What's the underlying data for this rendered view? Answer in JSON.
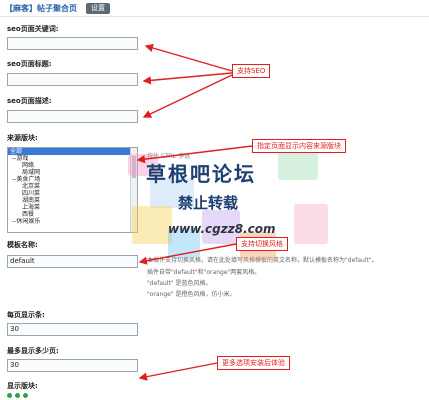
{
  "header": {
    "tag": "【麻客】",
    "title": "帖子聚合页",
    "settings_label": "设置"
  },
  "form": {
    "seo_keywords_label": "seo页面关键词:",
    "seo_title_label": "seo页面标题:",
    "seo_desc_label": "seo页面描述:",
    "source_label": "来源版块:",
    "ctrl_hint": "按住 CTRL 多选",
    "source_options": [
      "全部",
      "--游戏",
      "网络",
      "局域网",
      "--美食广场",
      "北京菜",
      "四川菜",
      "湖南菜",
      "上海菜",
      "西餐",
      "--休闲娱乐"
    ],
    "template_label": "模板名称:",
    "template_value": "default",
    "template_help": [
      "本插件支持切换风格，请在此处填写风格模板的英文名称，默认模板名称为\"default\"。",
      "插件自带\"default\"和\"orange\"两套风格。",
      "\"default\" 是蓝色风格。",
      "\"orange\" 是橙色风格，仿小米。"
    ],
    "per_page_label": "每页显示条:",
    "per_page_value": "30",
    "max_pages_label": "最多显示多少页:",
    "max_pages_value": "30",
    "display_forum_label": "显示版块:"
  },
  "annotations": {
    "seo": "支持SEO",
    "forum": "指定页面显示内容来源版块",
    "template": "支持切换风格",
    "more": "更多选项安装后体验"
  },
  "watermark": {
    "title": "草根吧论坛",
    "subtitle": "禁止转载",
    "url": "www.cgzz8.com"
  },
  "colors": {
    "accent": "#2860a8",
    "annotation": "#e02020",
    "selected": "#3b78d8"
  }
}
